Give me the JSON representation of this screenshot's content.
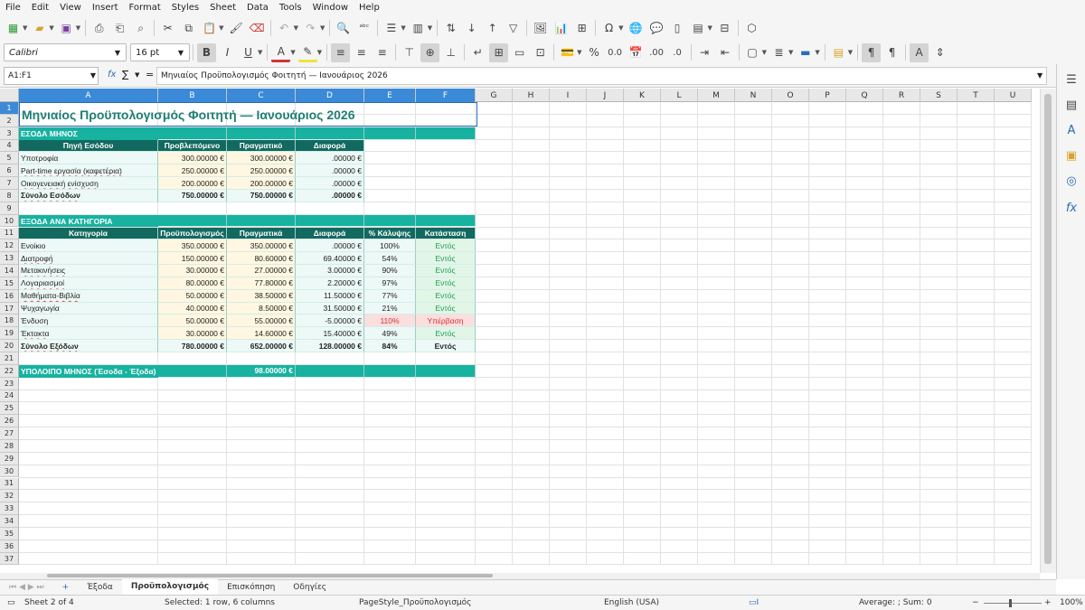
{
  "menu": [
    "File",
    "Edit",
    "View",
    "Insert",
    "Format",
    "Styles",
    "Sheet",
    "Data",
    "Tools",
    "Window",
    "Help"
  ],
  "font": {
    "name": "Calibri",
    "size": "16 pt"
  },
  "formula_bar": {
    "cell_ref": "A1:F1",
    "formula": "Μηνιαίος Προϋπολογισμός Φοιτητή — Ιανουάριος 2026",
    "fx": "fx",
    "sigma": "∑",
    "equals": "="
  },
  "columns": [
    "A",
    "B",
    "C",
    "D",
    "E",
    "F",
    "G",
    "H",
    "I",
    "J",
    "K",
    "L",
    "M",
    "N",
    "O",
    "P",
    "Q",
    "R",
    "S",
    "T",
    "U"
  ],
  "rows": [
    "1",
    "2",
    "3",
    "4",
    "5",
    "6",
    "7",
    "8",
    "9",
    "10",
    "11",
    "12",
    "13",
    "14",
    "15",
    "16",
    "17",
    "18",
    "19",
    "20",
    "21",
    "22",
    "23",
    "24",
    "25",
    "26",
    "27",
    "28",
    "29",
    "30",
    "31",
    "32",
    "33",
    "34",
    "35",
    "36",
    "37"
  ],
  "sheet": {
    "title": "Μηνιαίος Προϋπολογισμός Φοιτητή — Ιανουάριος 2026",
    "income_section": "ΕΣΟΔΑ ΜΗΝΟΣ",
    "income_headers": [
      "Πηγή Εσόδου",
      "Προβλεπόμενο",
      "Πραγματικό",
      "Διαφορά"
    ],
    "income_rows": [
      [
        "Υποτροφία",
        "300.00000 €",
        "300.00000 €",
        ".00000 €"
      ],
      [
        "Part-time εργασία (καφετέρια)",
        "250.00000 €",
        "250.00000 €",
        ".00000 €"
      ],
      [
        "Οικογενειακή ενίσχυση",
        "200.00000 €",
        "200.00000 €",
        ".00000 €"
      ]
    ],
    "income_total": [
      "Σύνολο Εσόδων",
      "750.00000 €",
      "750.00000 €",
      ".00000 €"
    ],
    "expense_section": "ΕΞΟΔΑ ΑΝΑ ΚΑΤΗΓΟΡΙΑ",
    "expense_headers": [
      "Κατηγορία",
      "Προϋπολογισμός",
      "Πραγματικά",
      "Διαφορά",
      "% Κάλυψης",
      "Κατάσταση"
    ],
    "expense_rows": [
      [
        "Ενοίκιο",
        "350.00000 €",
        "350.00000 €",
        ".00000 €",
        "100%",
        "Εντός"
      ],
      [
        "Διατροφή",
        "150.00000 €",
        "80.60000 €",
        "69.40000 €",
        "54%",
        "Εντός"
      ],
      [
        "Μετακινήσεις",
        "30.00000 €",
        "27.00000 €",
        "3.00000 €",
        "90%",
        "Εντός"
      ],
      [
        "Λογαριασμοί",
        "80.00000 €",
        "77.80000 €",
        "2.20000 €",
        "97%",
        "Εντός"
      ],
      [
        "Μαθήματα-Βιβλία",
        "50.00000 €",
        "38.50000 €",
        "11.50000 €",
        "77%",
        "Εντός"
      ],
      [
        "Ψυχαγωγία",
        "40.00000 €",
        "8.50000 €",
        "31.50000 €",
        "21%",
        "Εντός"
      ],
      [
        "Ένδυση",
        "50.00000 €",
        "55.00000 €",
        "-5.00000 €",
        "110%",
        "Υπέρβαση"
      ],
      [
        "Έκτακτα",
        "30.00000 €",
        "14.60000 €",
        "15.40000 €",
        "49%",
        "Εντός"
      ]
    ],
    "expense_total": [
      "Σύνολο Εξόδων",
      "780.00000 €",
      "652.00000 €",
      "128.00000 €",
      "84%",
      "Εντός"
    ],
    "balance_label": "ΥΠΟΛΟΙΠΟ ΜΗΝΟΣ (Έσοδα - Έξοδα)",
    "balance_value": "98.00000 €"
  },
  "tabs": [
    "Έξοδα",
    "Προϋπολογισμός",
    "Επισκόπηση",
    "Οδηγίες"
  ],
  "active_tab": "Προϋπολογισμός",
  "status": {
    "sheet": "Sheet 2 of 4",
    "selection": "Selected: 1 row, 6 columns",
    "page_style": "PageStyle_Προϋπολογισμός",
    "language": "English (USA)",
    "summary": "Average: ; Sum: 0",
    "zoom": "100%"
  },
  "colors": {
    "teal": "#17b2a0",
    "dark_teal": "#12695f",
    "selection": "#3a8ad8",
    "ok": "#1f9b53",
    "over": "#d23434"
  }
}
